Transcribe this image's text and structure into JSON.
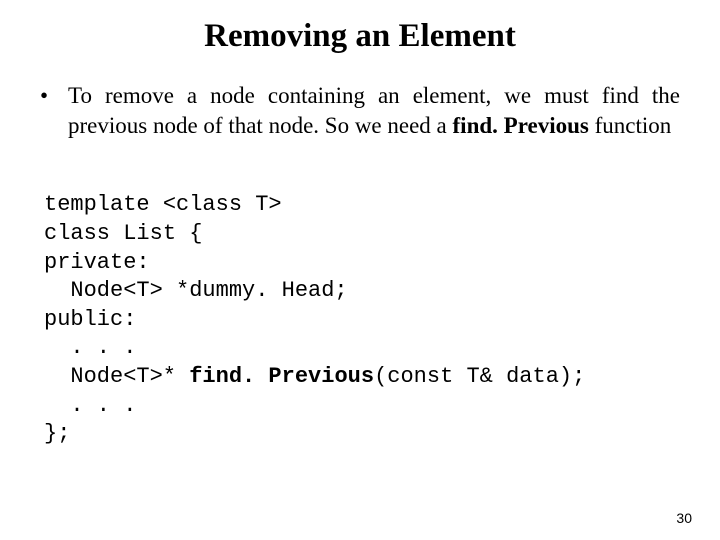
{
  "title": "Removing an Element",
  "bullet": {
    "marker": "•",
    "text_pre": "To remove a node containing an element, we must find the previous node of that node. So we need a ",
    "bold": "find. Previous",
    "text_post": " function"
  },
  "code": {
    "l1": "template <class T>",
    "l2": "class List {",
    "l3": "private:",
    "l4": "Node<T> *dummy. Head;",
    "l5": "public:",
    "l6": ". . .",
    "l7_pre": "Node<T>* ",
    "l7_bold": "find. Previous",
    "l7_post": "(const T& data);",
    "l8": ". . .",
    "l9": "};"
  },
  "page_number": "30"
}
